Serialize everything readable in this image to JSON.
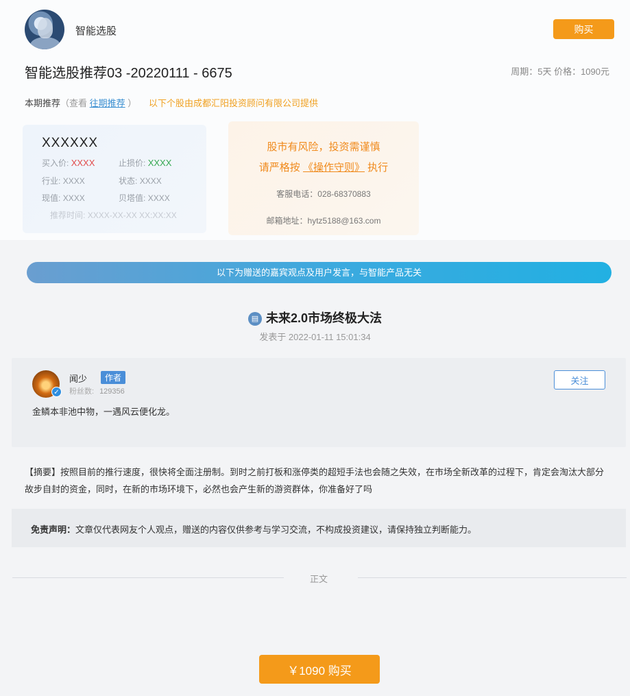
{
  "header": {
    "app_name": "智能选股",
    "buy_label": "购买"
  },
  "product": {
    "title": "智能选股推荐03 -20220111 - 6675",
    "period_text": "周期：5天 价格：1090元"
  },
  "recommend": {
    "label": "本期推荐",
    "paren_open": "（查看",
    "past_link": "往期推荐",
    "paren_close": "）",
    "provider": "以下个股由成都汇阳投资顾问有限公司提供"
  },
  "stock": {
    "code": "XXXXXX",
    "buy_price_label": "买入价:",
    "buy_price": "XXXX",
    "stop_loss_label": "止损价:",
    "stop_loss": "XXXX",
    "industry_label": "行业:",
    "industry": "XXXX",
    "status_label": "状态:",
    "status": "XXXX",
    "cap_label": "现值:",
    "cap": "XXXX",
    "beta_label": "贝塔值:",
    "beta": "XXXX",
    "time_label": "推荐时间:",
    "time": "XXXX-XX-XX XX:XX:XX"
  },
  "risk": {
    "line1": "股市有风险，投资需谨慎",
    "line2_pre": "请严格按",
    "line2_link": "《操作守则》",
    "line2_post": "执行",
    "phone": "客服电话：028-68370883",
    "email": "邮箱地址：hytz5188@163.com"
  },
  "banner": "以下为赠送的嘉宾观点及用户发言，与智能产品无关",
  "article": {
    "title": "未来2.0市场终极大法",
    "posted": "发表于 2022-01-11 15:01:34"
  },
  "author": {
    "name": "闻少",
    "tag": "作者",
    "fans_label": "粉丝数:",
    "fans": "129356",
    "follow_label": "关注",
    "bio": "金鳞本非池中物，一遇风云便化龙。"
  },
  "summary": "【摘要】按照目前的推行速度，很快将全面注册制。到时之前打板和涨停类的超短手法也会随之失效，在市场全新改革的过程下，肯定会淘汰大部分故步自封的资金，同时，在新的市场环境下，必然也会产生新的游资群体，你准备好了吗",
  "disclaimer": {
    "label": "免责声明：",
    "text": "文章仅代表网友个人观点，赠送的内容仅供参考与学习交流，不构成投资建议，请保持独立判断能力。"
  },
  "body_label": "正文",
  "footer": {
    "buy_label": "￥1090  购买"
  },
  "colors": {
    "accent_orange": "#f49a1a",
    "link_blue": "#3a8fd1",
    "price_red": "#e14b4b",
    "price_green": "#35a852"
  }
}
